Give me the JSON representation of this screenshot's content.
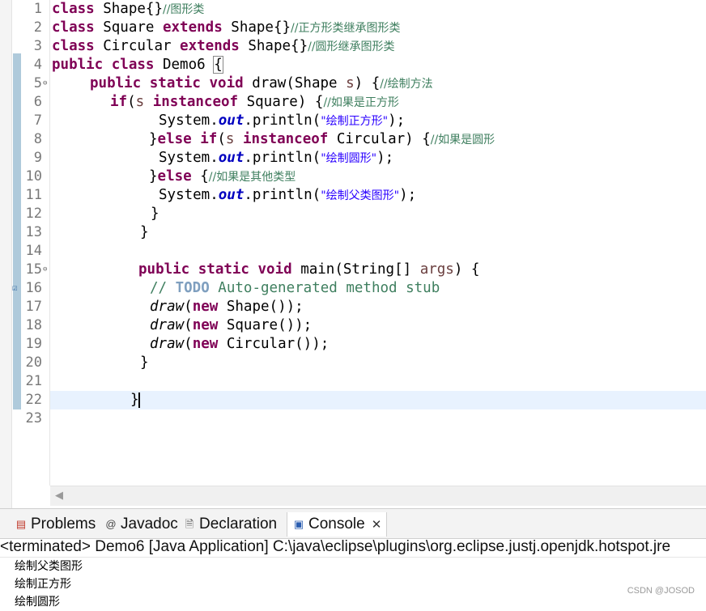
{
  "editor": {
    "line_numbers": [
      "1",
      "2",
      "3",
      "4",
      "5",
      "6",
      "7",
      "8",
      "9",
      "10",
      "11",
      "12",
      "13",
      "14",
      "15",
      "16",
      "17",
      "18",
      "19",
      "20",
      "21",
      "22",
      "23"
    ],
    "code": {
      "l1": {
        "kw": "class",
        "t": " Shape{}",
        "c": "//图形类"
      },
      "l2": {
        "kw1": "class",
        "t1": " Square ",
        "kw2": "extends",
        "t2": " Shape{}",
        "c": "//正方形类继承图形类"
      },
      "l3": {
        "kw1": "class",
        "t1": " Circular ",
        "kw2": "extends",
        "t2": " Shape{}",
        "c": "//圆形继承图形类"
      },
      "l4": {
        "kw": "public class",
        "t": " Demo6 ",
        "b": "{"
      },
      "l5": {
        "kw": "public static void",
        "t1": " draw(Shape ",
        "v": "s",
        "t2": ") {",
        "c": "//绘制方法"
      },
      "l6": {
        "kw": "if",
        "t1": "(",
        "v": "s",
        "kw2": " instanceof",
        "t2": " Square) {",
        "c": "//如果是正方形"
      },
      "l7": {
        "t1": "System.",
        "f": "out",
        "t2": ".println(",
        "s": "\"绘制正方形\"",
        "t3": ");"
      },
      "l8": {
        "t1": "}",
        "kw": "else if",
        "t2": "(",
        "v": "s",
        "kw2": " instanceof",
        "t3": " Circular) {",
        "c": "//如果是圆形"
      },
      "l9": {
        "t1": "System.",
        "f": "out",
        "t2": ".println(",
        "s": "\"绘制圆形\"",
        "t3": ");"
      },
      "l10": {
        "t1": "}",
        "kw": "else",
        "t2": " {",
        "c": "//如果是其他类型"
      },
      "l11": {
        "t1": "System.",
        "f": "out",
        "t2": ".println(",
        "s": "\"绘制父类图形\"",
        "t3": ");"
      },
      "l12": {
        "t": "}"
      },
      "l13": {
        "t": "}"
      },
      "l15": {
        "kw": "public static void",
        "t1": " main(String[] ",
        "v": "args",
        "t2": ") {"
      },
      "l16": {
        "c1": "// ",
        "todo": "TODO",
        "c2": " Auto-generated method stub"
      },
      "l17": {
        "m": "draw",
        "t1": "(",
        "kw": "new",
        "t2": " Shape());"
      },
      "l18": {
        "m": "draw",
        "t1": "(",
        "kw": "new",
        "t2": " Square());"
      },
      "l19": {
        "m": "draw",
        "t1": "(",
        "kw": "new",
        "t2": " Circular());"
      },
      "l20": {
        "t": "}"
      },
      "l22": {
        "t": "}"
      }
    }
  },
  "tabs": {
    "problems": "Problems",
    "javadoc": "Javadoc",
    "declaration": "Declaration",
    "console": "Console",
    "close": "✕"
  },
  "console": {
    "header": "<terminated> Demo6 [Java Application] C:\\java\\eclipse\\plugins\\org.eclipse.justj.openjdk.hotspot.jre",
    "output": [
      "绘制父类图形",
      "绘制正方形",
      "绘制圆形"
    ]
  },
  "watermark": "CSDN @JOSOD",
  "icons": {
    "problems": "problems-icon",
    "javadoc": "at-sign-icon",
    "declaration": "declaration-icon",
    "console": "console-icon",
    "fold": "fold-minus-icon",
    "task": "task-marker-icon"
  }
}
